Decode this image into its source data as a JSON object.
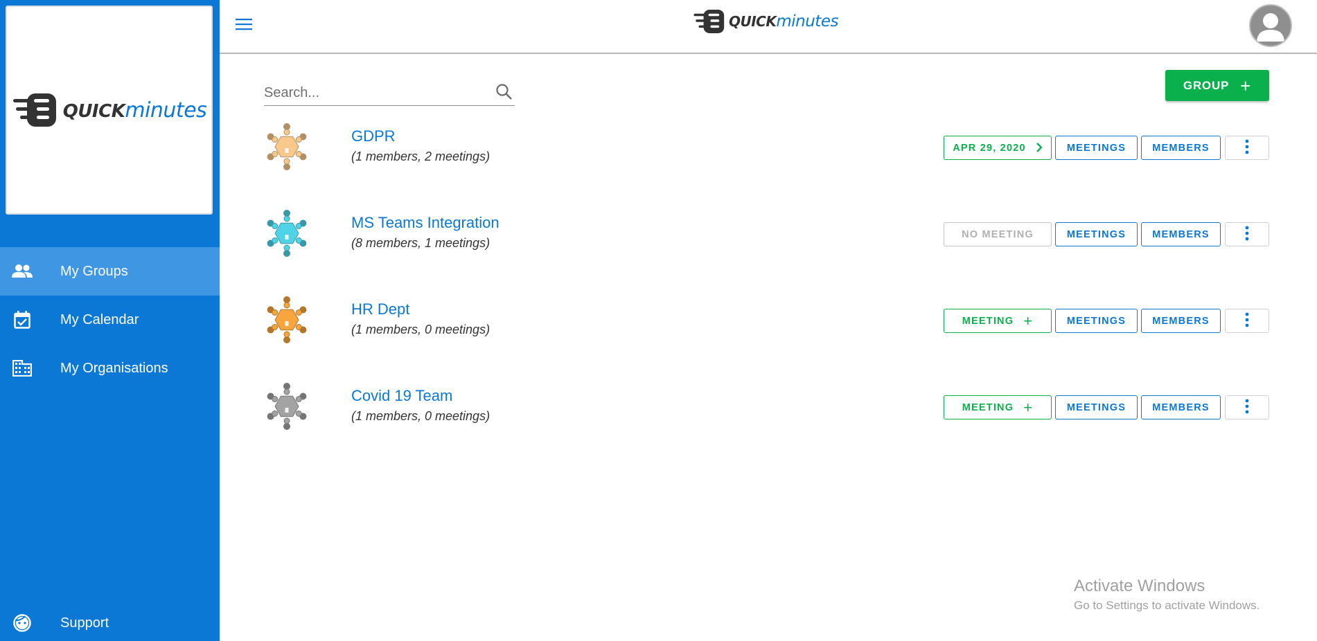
{
  "app": {
    "logo_quick": "QUICK",
    "logo_minutes": "minutes"
  },
  "colors": {
    "brand_blue": "#0a78d4",
    "sidebar_active": "#3f97e3",
    "green": "#0ab04c"
  },
  "sidebar": {
    "items": [
      {
        "label": "My Groups",
        "icon": "people-icon",
        "active": true
      },
      {
        "label": "My Calendar",
        "icon": "calendar-check-icon",
        "active": false
      },
      {
        "label": "My Organisations",
        "icon": "building-icon",
        "active": false
      }
    ],
    "support_label": "Support"
  },
  "search": {
    "placeholder": "Search..."
  },
  "toolbar": {
    "add_group_label": "GROUP"
  },
  "groups": [
    {
      "title": "GDPR",
      "subtitle": "(1 members, 2 meetings)",
      "status_label": "APR 29, 2020",
      "status_kind": "next-meeting",
      "meetings_label": "MEETINGS",
      "members_label": "MEMBERS",
      "icon_color": "#f9c88b"
    },
    {
      "title": "MS Teams Integration",
      "subtitle": "(8 members, 1 meetings)",
      "status_label": "NO MEETING",
      "status_kind": "none",
      "meetings_label": "MEETINGS",
      "members_label": "MEMBERS",
      "icon_color": "#4fd3e6"
    },
    {
      "title": "HR Dept",
      "subtitle": "(1 members, 0 meetings)",
      "status_label": "MEETING",
      "status_kind": "add",
      "meetings_label": "MEETINGS",
      "members_label": "MEMBERS",
      "icon_color": "#f7a53c"
    },
    {
      "title": "Covid 19 Team",
      "subtitle": "(1 members, 0 meetings)",
      "status_label": "MEETING",
      "status_kind": "add",
      "meetings_label": "MEETINGS",
      "members_label": "MEMBERS",
      "icon_color": "#a3a3a3"
    }
  ],
  "watermark": {
    "line1": "Activate Windows",
    "line2": "Go to Settings to activate Windows."
  }
}
